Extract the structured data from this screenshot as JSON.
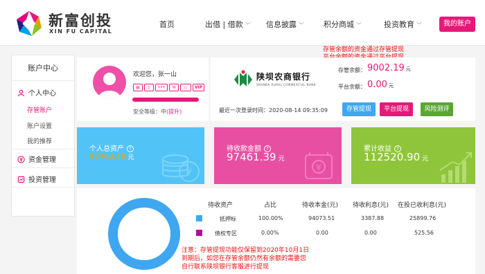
{
  "brand": {
    "name_cn": "新富创投",
    "name_en": "XIN FU CAPITAL"
  },
  "nav": {
    "items": [
      {
        "label": "首页",
        "dropdown": false
      },
      {
        "label": "出借 | 借款",
        "dropdown": true
      },
      {
        "label": "信息披露",
        "dropdown": true
      },
      {
        "label": "积分商城",
        "dropdown": true
      },
      {
        "label": "投资教育",
        "dropdown": true
      }
    ],
    "account_button": "我的账户"
  },
  "sidebar": {
    "title": "账户中心",
    "personal_center": "个人中心",
    "items": [
      "存管账户",
      "账户设置",
      "我的推荐"
    ],
    "active_index": 0,
    "fund_management": "资金管理",
    "investment_management": "投资管理"
  },
  "profile": {
    "welcome": "欢迎您，张一山",
    "badge_vip": "VIP",
    "security_label": "安全等级：中",
    "security_action": "(提升)"
  },
  "bank": {
    "name_cn": "陕坝农商银行",
    "name_en": "SHANBA RURAL COMMERCIAL BANK",
    "last_login": "最近一次登录时间：2020-08-14 09:35:09",
    "custody_balance_label": "存管余额：",
    "custody_balance_value": "9002.19",
    "platform_balance_label": "平台余额：",
    "platform_balance_value": "0.00",
    "currency": "元",
    "buttons": {
      "custody_withdraw": "存管提现",
      "platform_withdraw": "平台提现",
      "risk_assessment": "风险测评"
    }
  },
  "notice_top": {
    "line1": "存管余额的资金通过存管提现",
    "line2": "平台余额的资金通过平台提现"
  },
  "cards": {
    "total_assets_label": "个人总资产",
    "total_assets_value": "97463.48",
    "receivable_label": "待收款金额",
    "receivable_value": "97461.39",
    "cumulative_income_label": "累计收益",
    "cumulative_income_value": "112520.90",
    "unit": "元",
    "help_glyph": "?"
  },
  "assets_table": {
    "headers": [
      "待收资产",
      "占比",
      "待收本金(元)",
      "待收利息(元)",
      "在投已收利息(元)"
    ],
    "rows": [
      {
        "name": "抵押标",
        "ratio": "100.00%",
        "principal": "94073.51",
        "interest": "3387.88",
        "received": "25899.76",
        "color": "#3ea7f0"
      },
      {
        "name": "债权专区",
        "ratio": "0.00%",
        "principal": "0.00",
        "interest": "0.00",
        "received": "525.56",
        "color": "#b10f9b"
      }
    ]
  },
  "notice_bottom": {
    "line1": "注意：存管提现功能仅保留到2020年10月1日",
    "line2": "到期后，如您在存管余额仍然有余额的需要您",
    "line3": "自行联系陕坝银行客服进行提现"
  },
  "colors": {
    "brand": "#e6197a",
    "blue_card": "#52c3f6",
    "pink_card": "#e84fa3",
    "green_card": "#8fc53b",
    "notice": "#f01010"
  }
}
